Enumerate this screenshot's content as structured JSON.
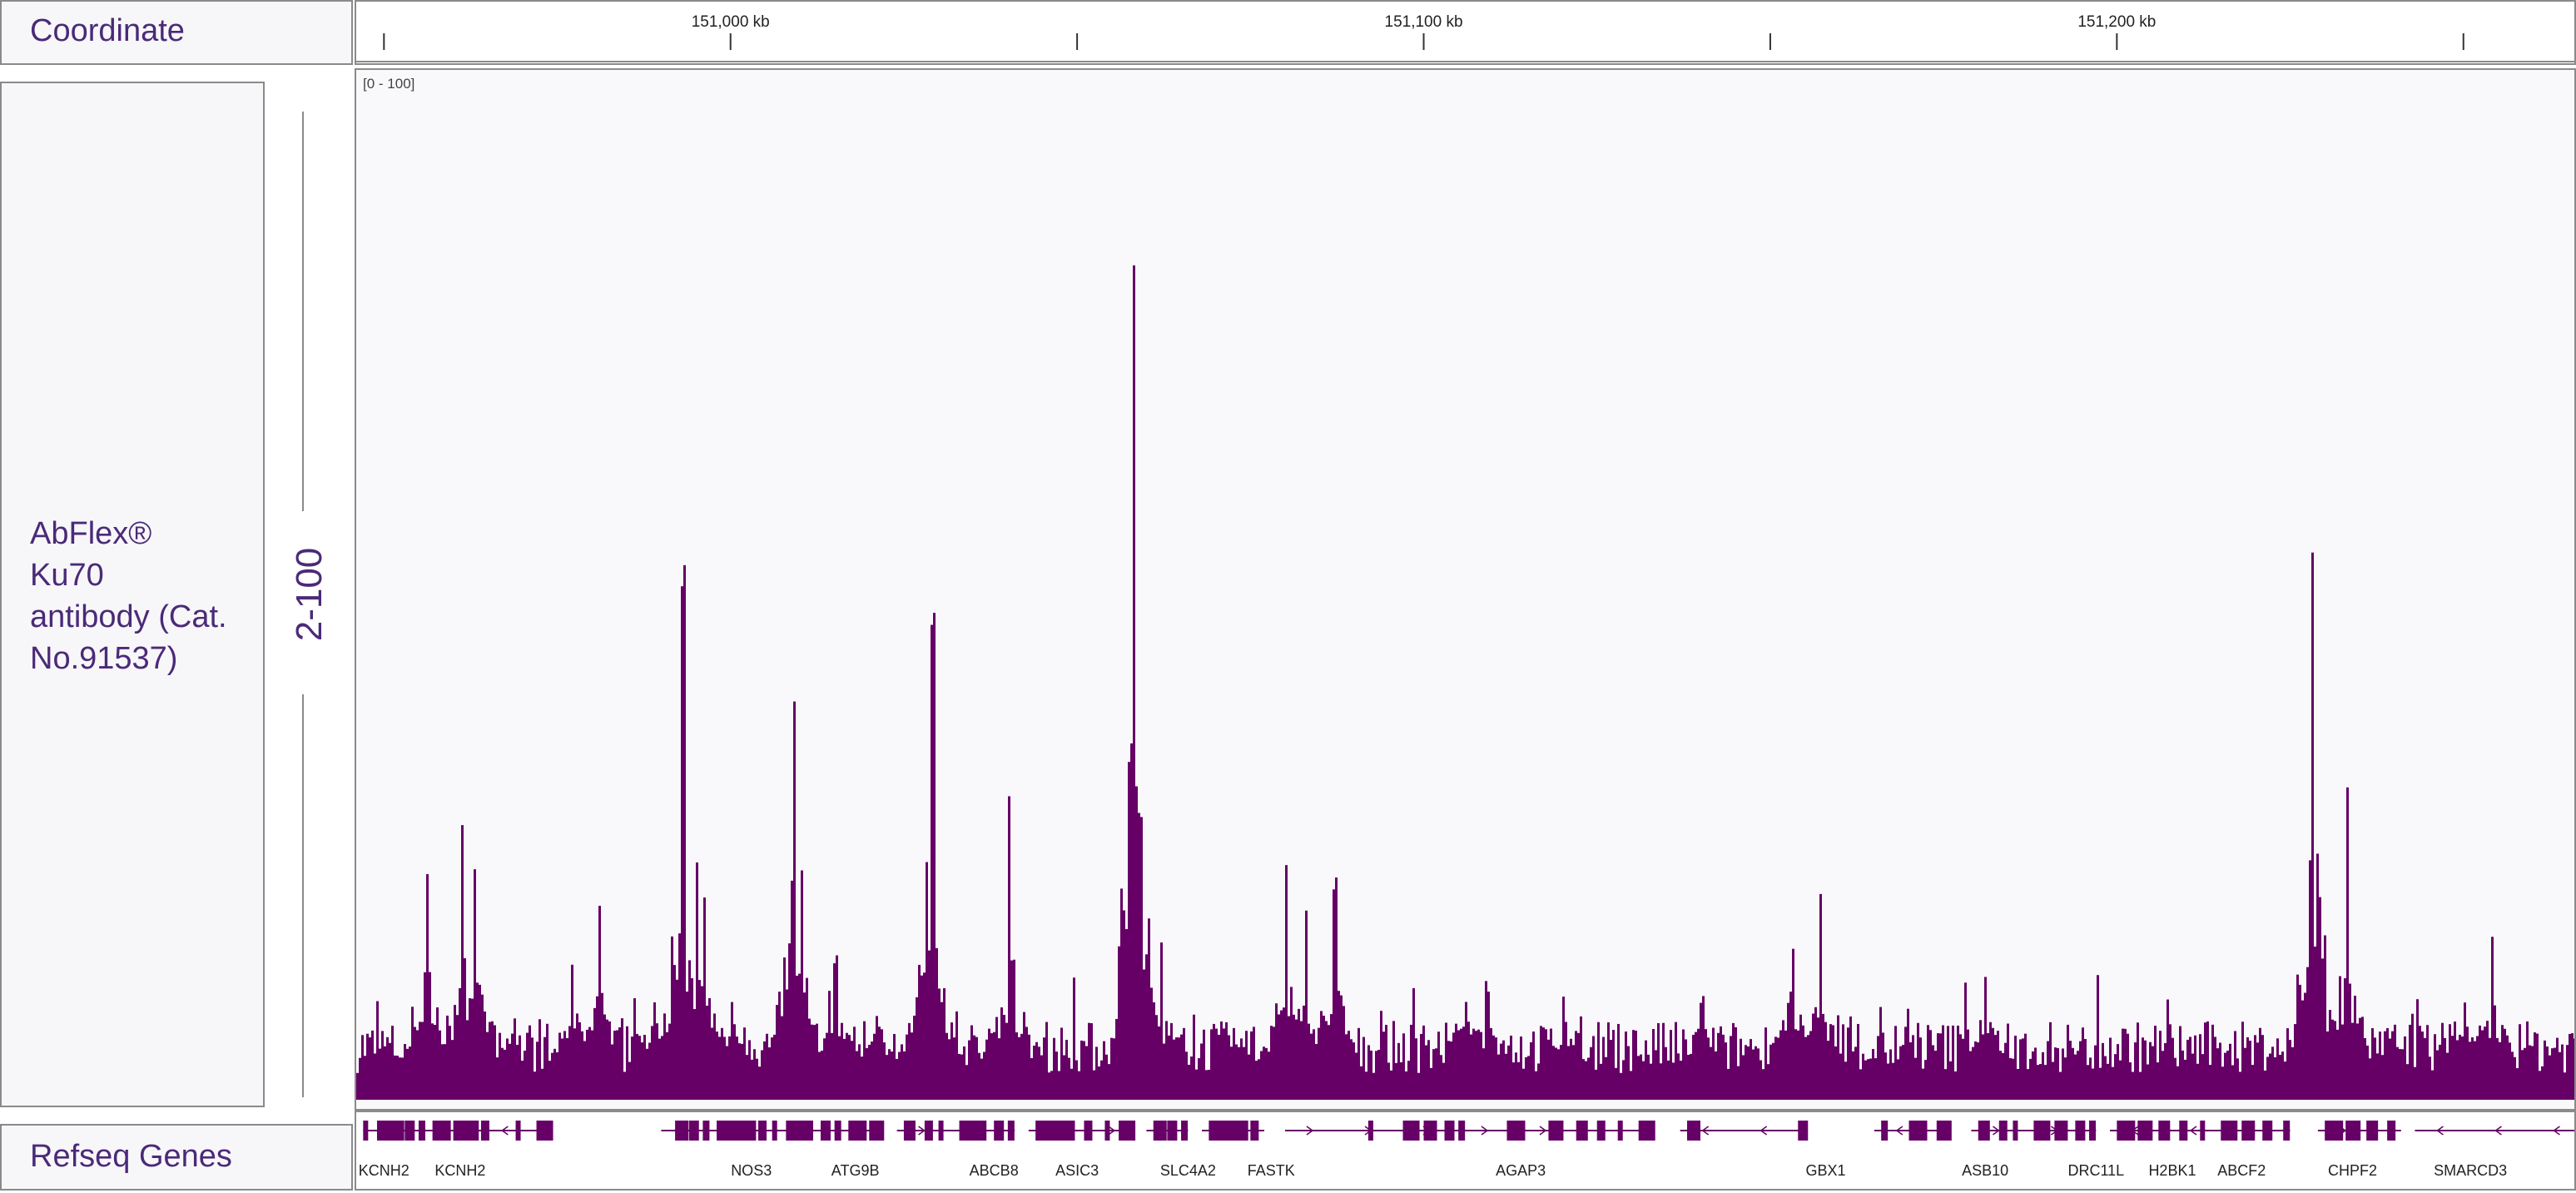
{
  "colors": {
    "signal": "#660066",
    "label_text": "#4b2a78",
    "border": "#8a8a8a",
    "panel_bg": "#f7f7f9"
  },
  "coordinate_track": {
    "label": "Coordinate",
    "ticks": [
      {
        "label": "151,000 kb",
        "pos": 151000
      },
      {
        "label": "151,100 kb",
        "pos": 151100
      },
      {
        "label": "151,200 kb",
        "pos": 151200
      }
    ],
    "minor_ticks": [
      150950,
      151050,
      151150,
      151250
    ]
  },
  "signal_track": {
    "label": "AbFlex®\nKu70\nantibody (Cat.\nNo.91537)",
    "scale": "2-100",
    "range_label": "[0 - 100]",
    "view_start_kb": 150946,
    "view_end_kb": 151266,
    "ymax": 100,
    "peaks": [
      {
        "kb": 150956,
        "h": 28
      },
      {
        "kb": 150961,
        "h": 32
      },
      {
        "kb": 150963,
        "h": 27
      },
      {
        "kb": 150977,
        "h": 17
      },
      {
        "kb": 150981,
        "h": 23
      },
      {
        "kb": 150989,
        "h": 13
      },
      {
        "kb": 150993,
        "h": 62
      },
      {
        "kb": 150995,
        "h": 30
      },
      {
        "kb": 150996,
        "h": 26
      },
      {
        "kb": 151000,
        "h": 12
      },
      {
        "kb": 151009,
        "h": 52
      },
      {
        "kb": 151010,
        "h": 30
      },
      {
        "kb": 151015,
        "h": 17
      },
      {
        "kb": 151021,
        "h": 10
      },
      {
        "kb": 151029,
        "h": 60
      },
      {
        "kb": 151028,
        "h": 30
      },
      {
        "kb": 151040,
        "h": 36
      },
      {
        "kb": 151058,
        "h": 100
      },
      {
        "kb": 151059,
        "h": 36
      },
      {
        "kb": 151062,
        "h": 19
      },
      {
        "kb": 151080,
        "h": 28
      },
      {
        "kb": 151083,
        "h": 24
      },
      {
        "kb": 151087,
        "h": 26
      },
      {
        "kb": 151106,
        "h": 13
      },
      {
        "kb": 151109,
        "h": 14
      },
      {
        "kb": 151120,
        "h": 12
      },
      {
        "kb": 151140,
        "h": 12
      },
      {
        "kb": 151153,
        "h": 20
      },
      {
        "kb": 151157,
        "h": 24
      },
      {
        "kb": 151181,
        "h": 16
      },
      {
        "kb": 151228,
        "h": 70
      },
      {
        "kb": 151233,
        "h": 36
      },
      {
        "kb": 151254,
        "h": 20
      },
      {
        "kb": 151250,
        "h": 12
      }
    ]
  },
  "genes_track": {
    "label": "Refseq Genes",
    "genes": [
      {
        "name": "KCNH2",
        "label_kb": 150950
      },
      {
        "name": "KCNH2",
        "label_kb": 150961
      },
      {
        "name": "NOS3",
        "label_kb": 151003
      },
      {
        "name": "ATG9B",
        "label_kb": 151018
      },
      {
        "name": "ABCB8",
        "label_kb": 151038
      },
      {
        "name": "ASIC3",
        "label_kb": 151050
      },
      {
        "name": "SLC4A2",
        "label_kb": 151066
      },
      {
        "name": "FASTK",
        "label_kb": 151078
      },
      {
        "name": "AGAP3",
        "label_kb": 151114
      },
      {
        "name": "GBX1",
        "label_kb": 151158
      },
      {
        "name": "ASB10",
        "label_kb": 151181
      },
      {
        "name": "DRC11L",
        "label_kb": 151197
      },
      {
        "name": "H2BK1",
        "label_kb": 151208
      },
      {
        "name": "ABCF2",
        "label_kb": 151218
      },
      {
        "name": "CHPF2",
        "label_kb": 151234
      },
      {
        "name": "SMARCD3",
        "label_kb": 151251
      }
    ],
    "segments": [
      {
        "start": 150947,
        "end": 150974,
        "dir": "<"
      },
      {
        "start": 150990,
        "end": 151022,
        "dir": ">"
      },
      {
        "start": 151024,
        "end": 151041,
        "dir": ">"
      },
      {
        "start": 151043,
        "end": 151058,
        "dir": ">"
      },
      {
        "start": 151060,
        "end": 151066,
        "dir": ">"
      },
      {
        "start": 151068,
        "end": 151077,
        "dir": ">"
      },
      {
        "start": 151080,
        "end": 151133,
        "dir": ">"
      },
      {
        "start": 151137,
        "end": 151155,
        "dir": "<"
      },
      {
        "start": 151165,
        "end": 151176,
        "dir": "<"
      },
      {
        "start": 151179,
        "end": 151197,
        "dir": ">"
      },
      {
        "start": 151199,
        "end": 151225,
        "dir": "<"
      },
      {
        "start": 151229,
        "end": 151241,
        "dir": ">"
      },
      {
        "start": 151243,
        "end": 151266,
        "dir": "<"
      }
    ],
    "exons": [
      150947,
      150949,
      150951,
      150953,
      150955,
      150957,
      150960,
      150962,
      150964,
      150969,
      150972,
      150992,
      150994,
      150996,
      150998,
      151000,
      151002,
      151004,
      151006,
      151008,
      151010,
      151013,
      151015,
      151017,
      151020,
      151025,
      151028,
      151030,
      151033,
      151035,
      151038,
      151040,
      151044,
      151046,
      151048,
      151051,
      151054,
      151056,
      151061,
      151063,
      151065,
      151069,
      151071,
      151073,
      151075,
      151092,
      151097,
      151100,
      151103,
      151105,
      151112,
      151118,
      151122,
      151125,
      151128,
      151131,
      151138,
      151154,
      151166,
      151170,
      151174,
      151180,
      151183,
      151185,
      151188,
      151191,
      151194,
      151196,
      151200,
      151203,
      151206,
      151209,
      151212,
      151215,
      151218,
      151221,
      151224,
      151230,
      151233,
      151236,
      151239
    ]
  }
}
